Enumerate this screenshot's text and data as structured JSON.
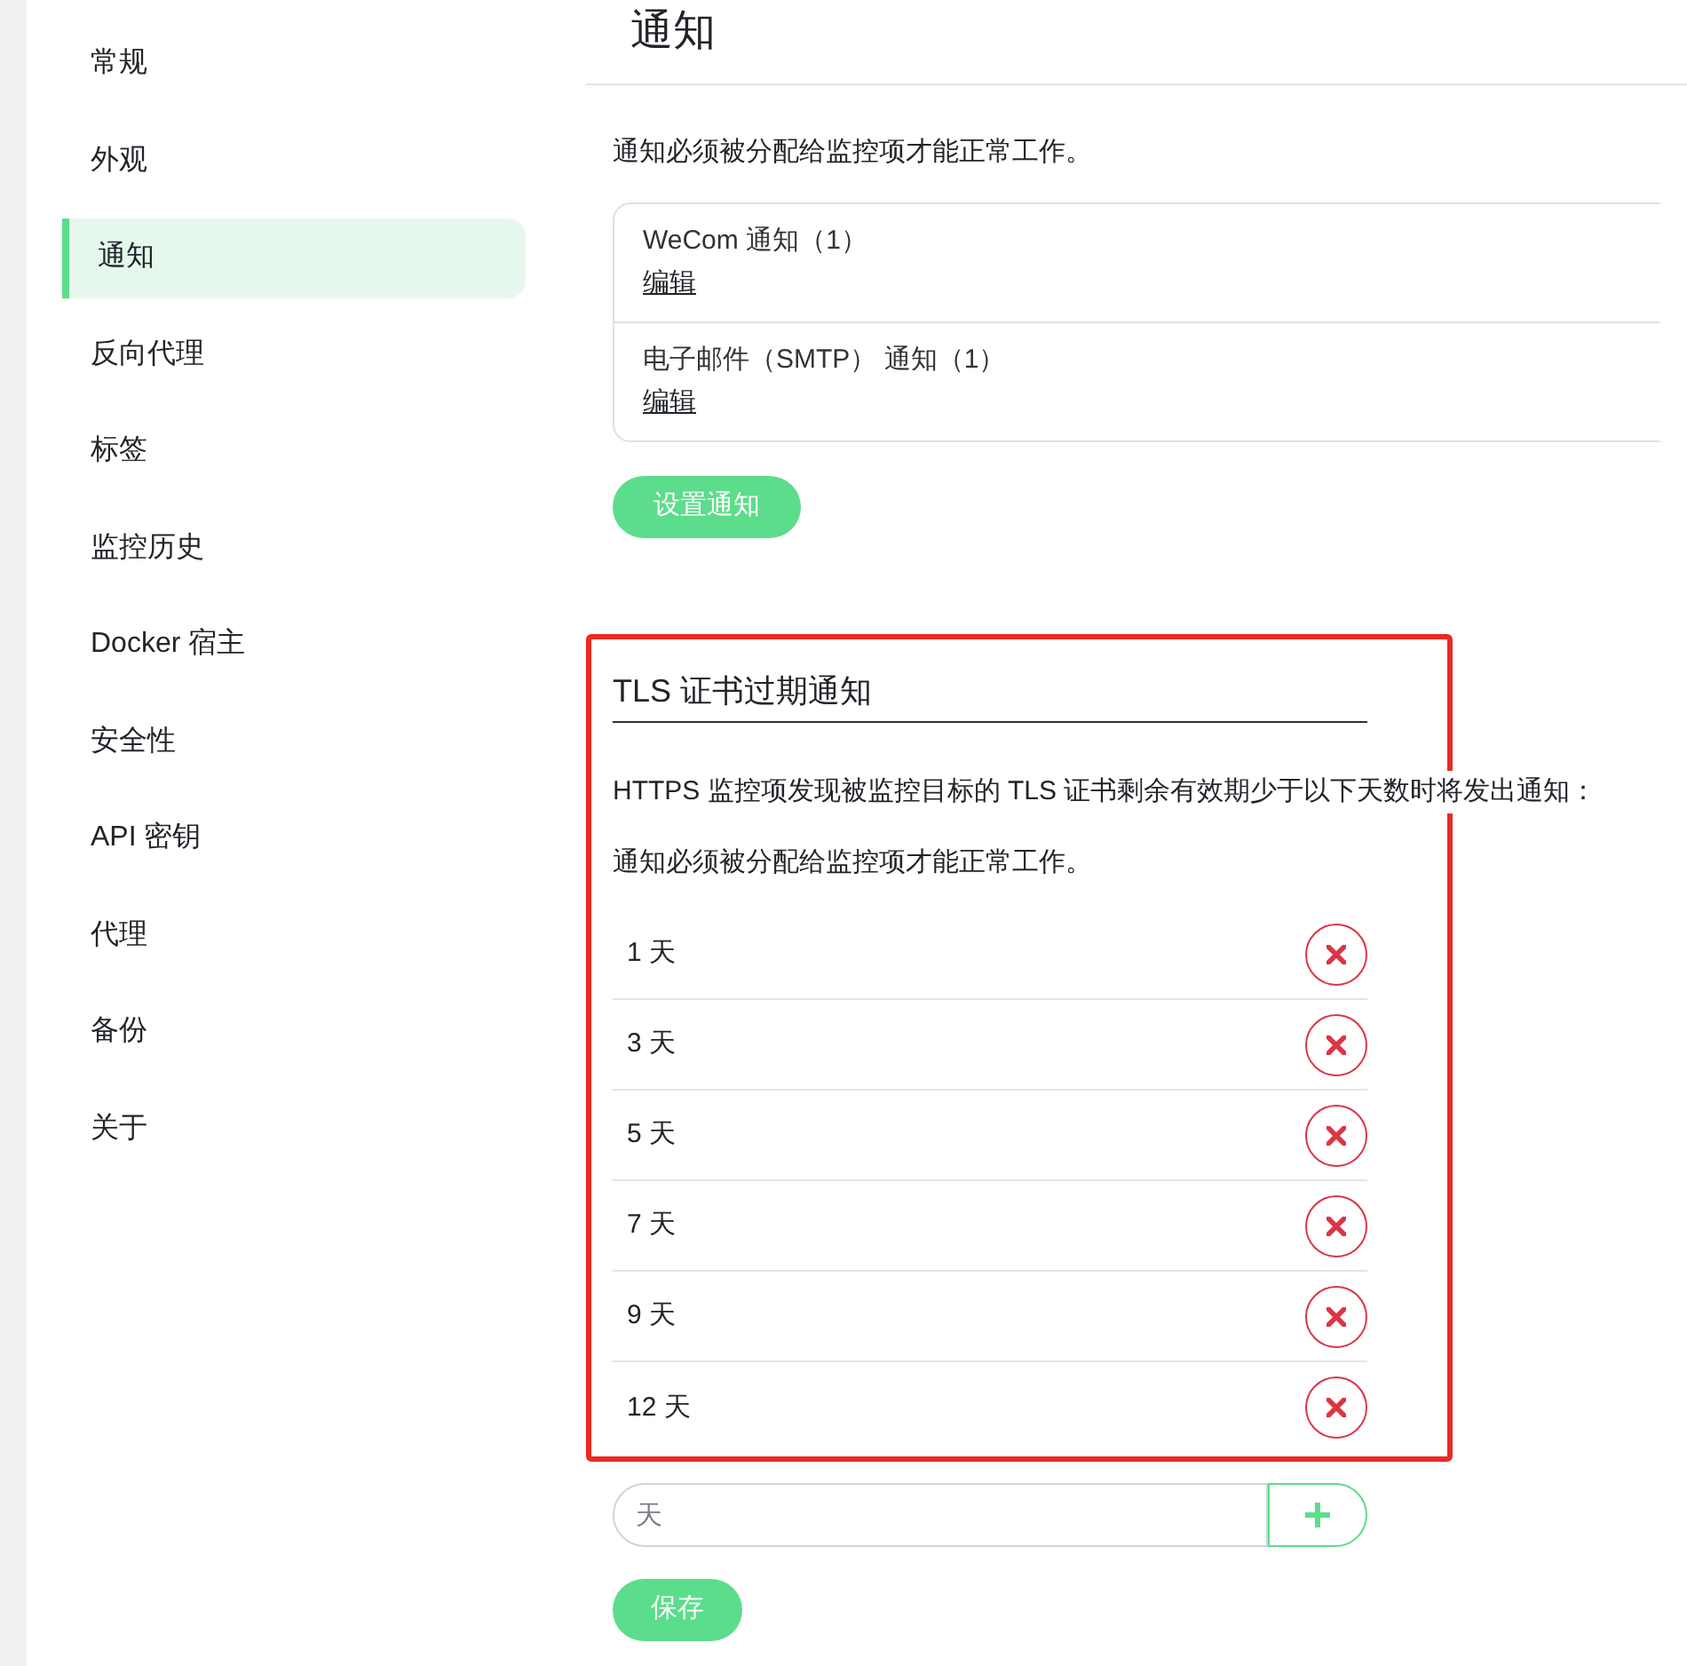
{
  "sidebar": {
    "items": [
      {
        "label": "常规",
        "selected": false
      },
      {
        "label": "外观",
        "selected": false
      },
      {
        "label": "通知",
        "selected": true
      },
      {
        "label": "反向代理",
        "selected": false
      },
      {
        "label": "标签",
        "selected": false
      },
      {
        "label": "监控历史",
        "selected": false
      },
      {
        "label": "Docker 宿主",
        "selected": false
      },
      {
        "label": "安全性",
        "selected": false
      },
      {
        "label": "API 密钥",
        "selected": false
      },
      {
        "label": "代理",
        "selected": false
      },
      {
        "label": "备份",
        "selected": false
      },
      {
        "label": "关于",
        "selected": false
      }
    ]
  },
  "header": {
    "title": "通知"
  },
  "notifications": {
    "note": "通知必须被分配给监控项才能正常工作。",
    "items": [
      {
        "name": "WeCom 通知（1）",
        "action": "编辑"
      },
      {
        "name": "电子邮件（SMTP） 通知（1）",
        "action": "编辑"
      }
    ],
    "setup_button": "设置通知"
  },
  "tls_expiry": {
    "title": "TLS 证书过期通知",
    "description": "HTTPS 监控项发现被监控目标的 TLS 证书剩余有效期少于以下天数时将发出通知：",
    "note": "通知必须被分配给监控项才能正常工作。",
    "days": [
      {
        "label": "1 天"
      },
      {
        "label": "3 天"
      },
      {
        "label": "5 天"
      },
      {
        "label": "7 天"
      },
      {
        "label": "9 天"
      },
      {
        "label": "12 天"
      }
    ],
    "day_input": {
      "placeholder": "天"
    },
    "save_button": "保存"
  }
}
